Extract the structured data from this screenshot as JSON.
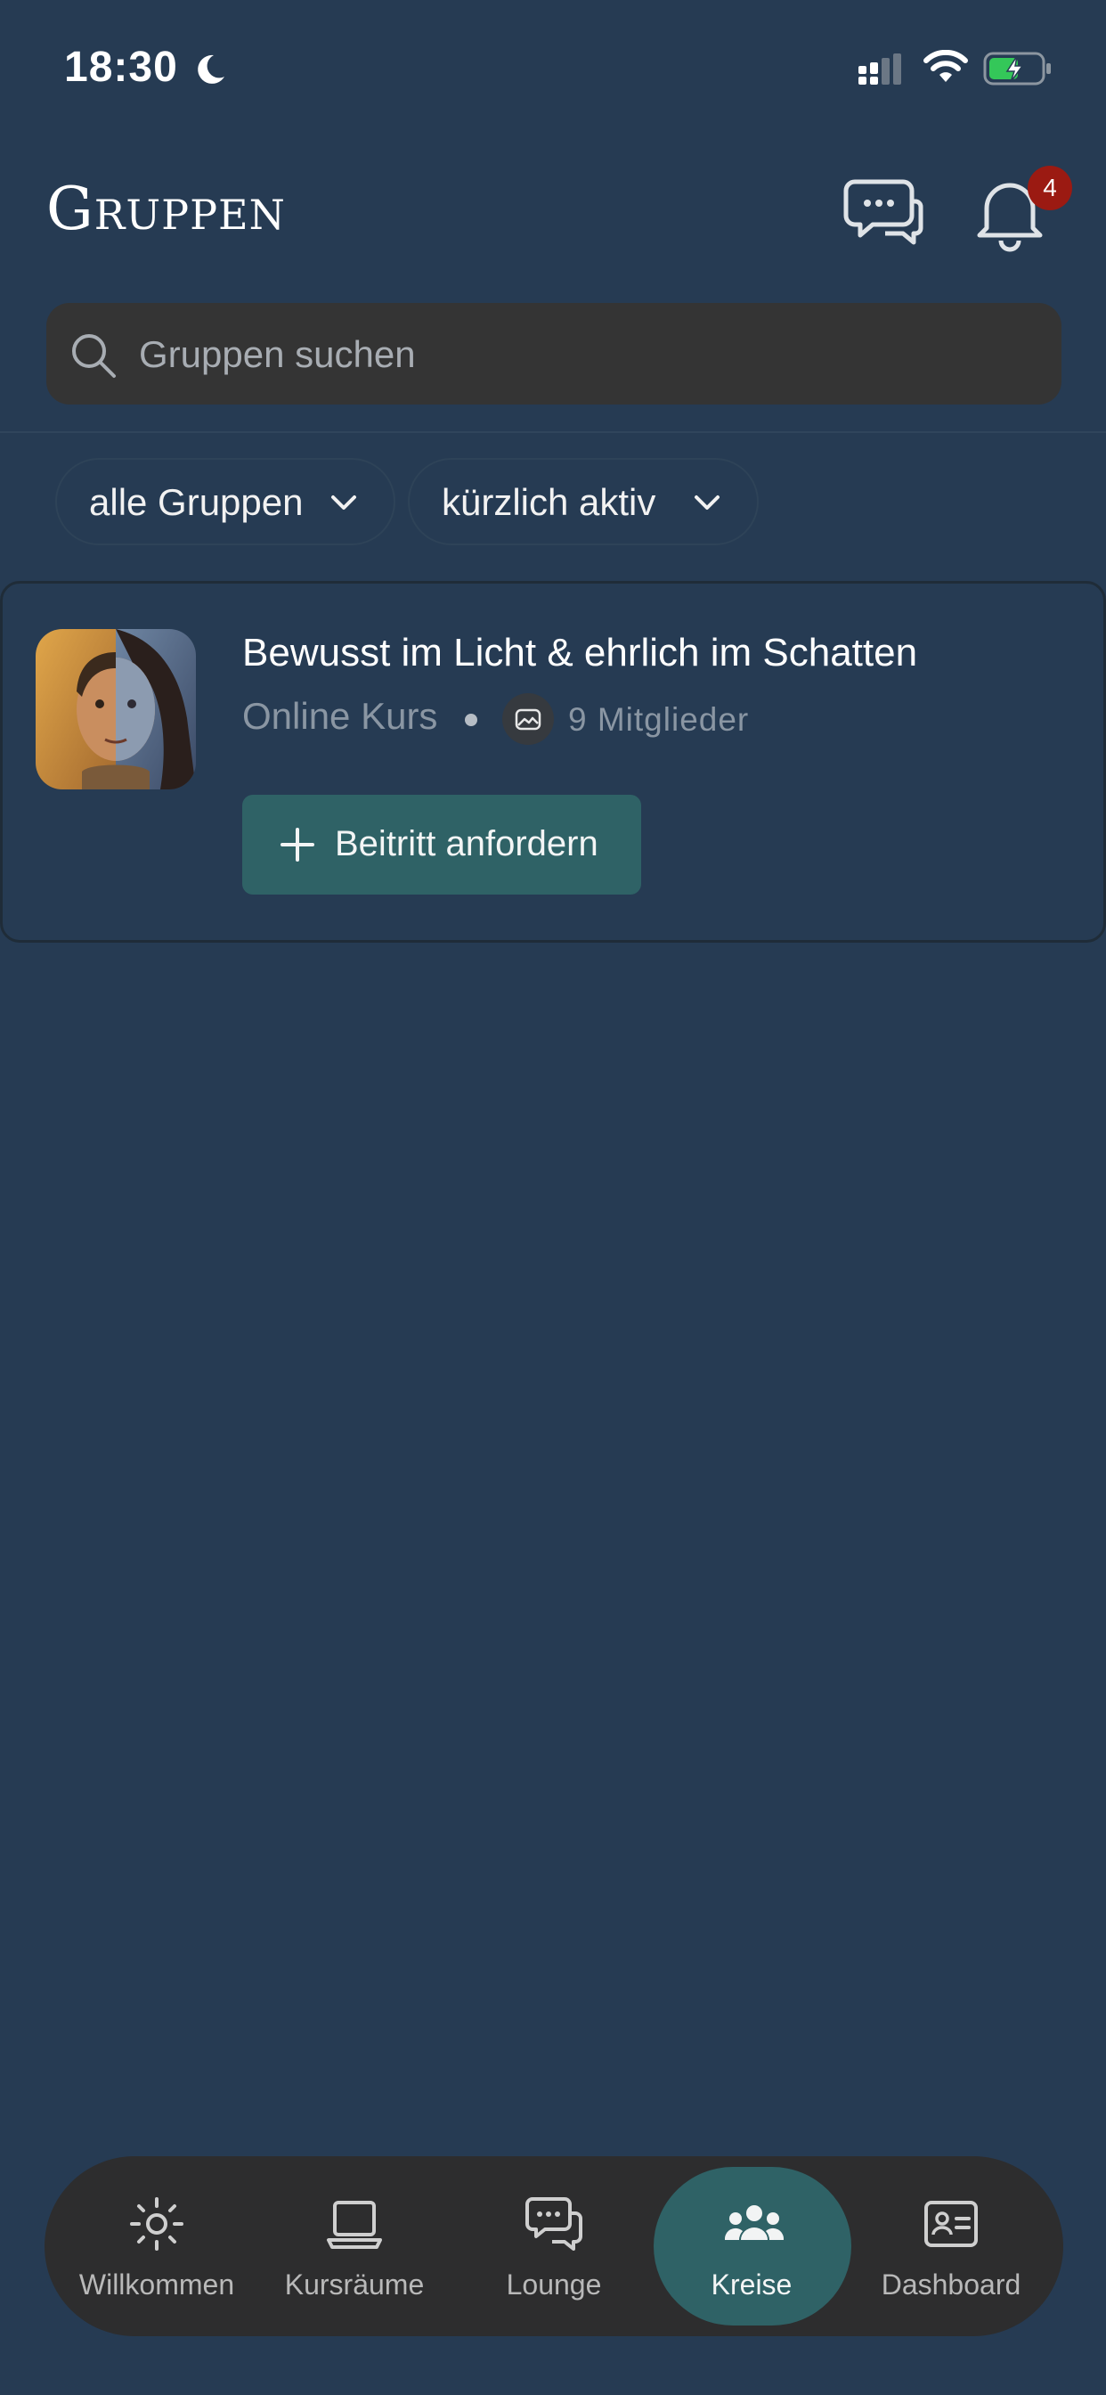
{
  "status_bar": {
    "time": "18:30"
  },
  "header": {
    "title": "Gruppen",
    "notification_count": "4"
  },
  "search": {
    "placeholder": "Gruppen suchen"
  },
  "filters": [
    {
      "label": "alle Gruppen"
    },
    {
      "label": "kürzlich aktiv"
    }
  ],
  "groups": [
    {
      "title": "Bewusst im Licht & ehrlich im Schatten",
      "type": "Online Kurs",
      "members": "9 Mitglieder",
      "join_label": "Beitritt anfordern"
    }
  ],
  "tabs": [
    {
      "label": "Willkommen",
      "icon": "sun-icon"
    },
    {
      "label": "Kursräume",
      "icon": "laptop-icon"
    },
    {
      "label": "Lounge",
      "icon": "chat-bubbles-icon"
    },
    {
      "label": "Kreise",
      "icon": "people-icon",
      "active": true
    },
    {
      "label": "Dashboard",
      "icon": "id-card-icon"
    }
  ],
  "colors": {
    "background": "#263b53",
    "accent": "#2f6266",
    "badge": "#9b1a12",
    "battery": "#34c759"
  }
}
